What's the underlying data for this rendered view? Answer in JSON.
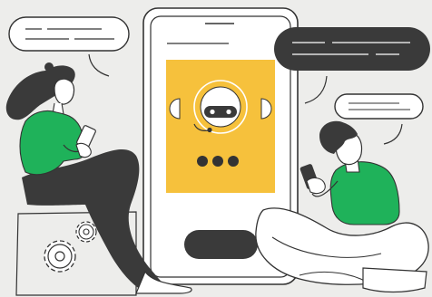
{
  "colors": {
    "background": "#ededeb",
    "ink": "#333333",
    "dark": "#3a3a3a",
    "accent_yellow": "#f6c13c",
    "accent_green": "#1fb25a",
    "white": "#ffffff"
  },
  "illustration": {
    "phone": {
      "screen_graphic": "chatbot-robot-avatar",
      "typing_indicator_dots": 3,
      "action_button_icon": "pill-button"
    },
    "speech_bubbles": [
      {
        "style": "light",
        "content": "placeholder-lines"
      },
      {
        "style": "dark",
        "content": "placeholder-lines"
      },
      {
        "style": "light",
        "content": "placeholder-lines"
      }
    ],
    "people": [
      {
        "role": "woman-sitting-with-phone",
        "shirt_color": "#1fb25a"
      },
      {
        "role": "man-cross-legged-with-phone",
        "shirt_color": "#1fb25a"
      }
    ],
    "decor": [
      "gear-icon-large",
      "gear-icon-small",
      "cushion"
    ]
  }
}
